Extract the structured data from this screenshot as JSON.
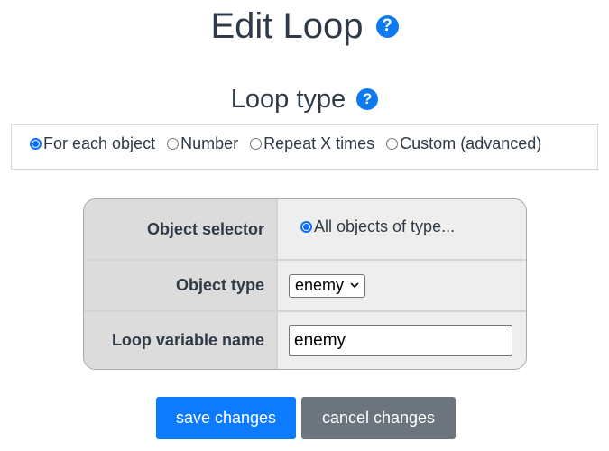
{
  "header": {
    "title": "Edit Loop",
    "help_glyph": "?"
  },
  "loop_type": {
    "title": "Loop type",
    "help_glyph": "?",
    "options": [
      {
        "label": "For each object",
        "checked": true
      },
      {
        "label": "Number",
        "checked": false
      },
      {
        "label": "Repeat X times",
        "checked": false
      },
      {
        "label": "Custom (advanced)",
        "checked": false
      }
    ]
  },
  "settings": {
    "object_selector": {
      "label": "Object selector",
      "option": "All objects of type...",
      "checked": true
    },
    "object_type": {
      "label": "Object type",
      "value": "enemy"
    },
    "loop_variable": {
      "label": "Loop variable name",
      "value": "enemy"
    }
  },
  "actions": {
    "save_label": "save changes",
    "cancel_label": "cancel changes"
  },
  "colors": {
    "primary": "#0d7bff",
    "secondary": "#6c757d",
    "text": "#2f3a46"
  }
}
